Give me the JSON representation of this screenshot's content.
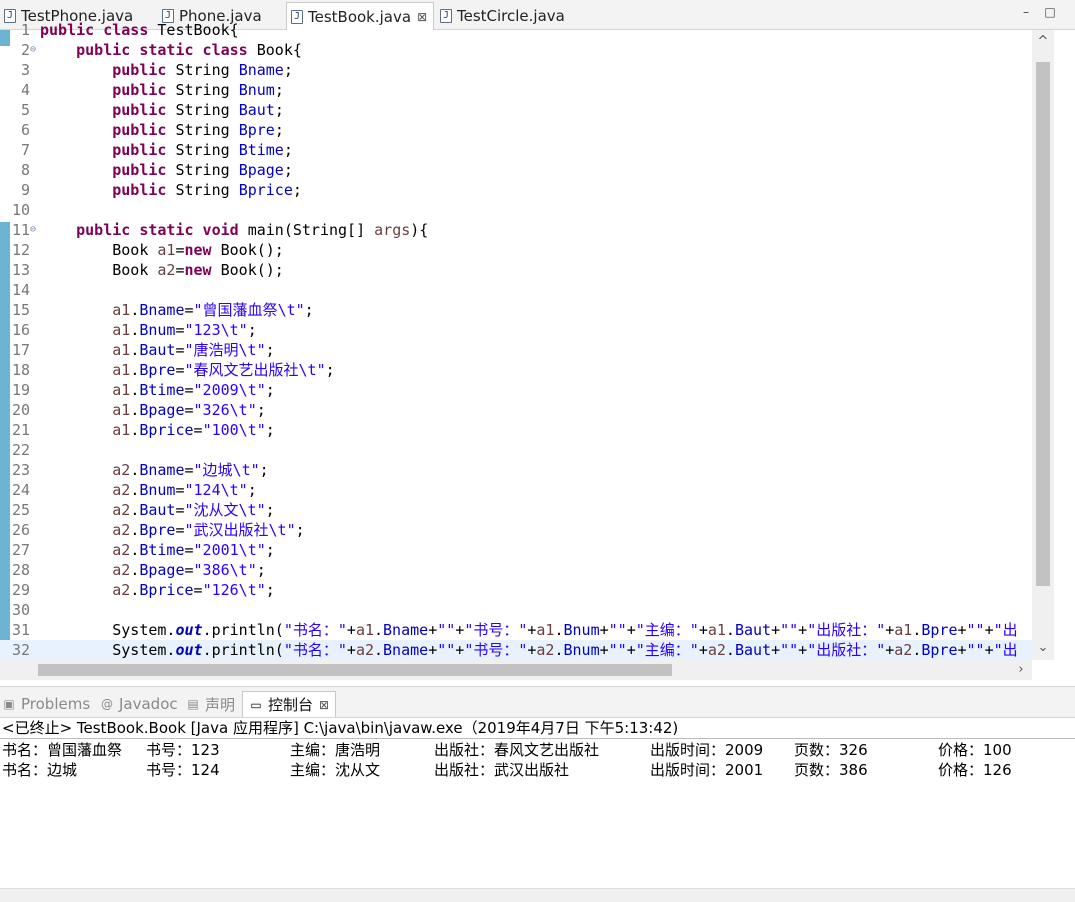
{
  "editor_tabs": [
    {
      "label": "TestPhone.java",
      "icon": "java-file-icon"
    },
    {
      "label": "Phone.java",
      "icon": "java-file-icon"
    },
    {
      "label": "TestBook.java",
      "icon": "java-file-icon",
      "active": true,
      "close": "⊠"
    },
    {
      "label": "TestCircle.java",
      "icon": "java-file-icon"
    }
  ],
  "window_buttons": {
    "minimize": "–",
    "maximize": "□"
  },
  "code_lines": [
    {
      "n": "1",
      "tokens": [
        {
          "t": "public class ",
          "c": "kw"
        },
        {
          "t": "TestBook{",
          "c": ""
        }
      ]
    },
    {
      "n": "2",
      "fold": "⊖",
      "tokens": [
        {
          "t": "    ",
          "c": ""
        },
        {
          "t": "public static class ",
          "c": "kw"
        },
        {
          "t": "Book{",
          "c": ""
        }
      ]
    },
    {
      "n": "3",
      "tokens": [
        {
          "t": "        ",
          "c": ""
        },
        {
          "t": "public ",
          "c": "kw"
        },
        {
          "t": "String ",
          "c": ""
        },
        {
          "t": "Bname",
          "c": "fld"
        },
        {
          "t": ";",
          "c": ""
        }
      ]
    },
    {
      "n": "4",
      "tokens": [
        {
          "t": "        ",
          "c": ""
        },
        {
          "t": "public ",
          "c": "kw"
        },
        {
          "t": "String ",
          "c": ""
        },
        {
          "t": "Bnum",
          "c": "fld"
        },
        {
          "t": ";",
          "c": ""
        }
      ]
    },
    {
      "n": "5",
      "tokens": [
        {
          "t": "        ",
          "c": ""
        },
        {
          "t": "public ",
          "c": "kw"
        },
        {
          "t": "String ",
          "c": ""
        },
        {
          "t": "Baut",
          "c": "fld"
        },
        {
          "t": ";",
          "c": ""
        }
      ]
    },
    {
      "n": "6",
      "tokens": [
        {
          "t": "        ",
          "c": ""
        },
        {
          "t": "public ",
          "c": "kw"
        },
        {
          "t": "String ",
          "c": ""
        },
        {
          "t": "Bpre",
          "c": "fld"
        },
        {
          "t": ";",
          "c": ""
        }
      ]
    },
    {
      "n": "7",
      "tokens": [
        {
          "t": "        ",
          "c": ""
        },
        {
          "t": "public ",
          "c": "kw"
        },
        {
          "t": "String ",
          "c": ""
        },
        {
          "t": "Btime",
          "c": "fld"
        },
        {
          "t": ";",
          "c": ""
        }
      ]
    },
    {
      "n": "8",
      "tokens": [
        {
          "t": "        ",
          "c": ""
        },
        {
          "t": "public ",
          "c": "kw"
        },
        {
          "t": "String ",
          "c": ""
        },
        {
          "t": "Bpage",
          "c": "fld"
        },
        {
          "t": ";",
          "c": ""
        }
      ]
    },
    {
      "n": "9",
      "tokens": [
        {
          "t": "        ",
          "c": ""
        },
        {
          "t": "public ",
          "c": "kw"
        },
        {
          "t": "String ",
          "c": ""
        },
        {
          "t": "Bprice",
          "c": "fld"
        },
        {
          "t": ";",
          "c": ""
        }
      ]
    },
    {
      "n": "10",
      "tokens": []
    },
    {
      "n": "11",
      "fold": "⊖",
      "tokens": [
        {
          "t": "    ",
          "c": ""
        },
        {
          "t": "public static void ",
          "c": "kw"
        },
        {
          "t": "main(String[] ",
          "c": ""
        },
        {
          "t": "args",
          "c": "var"
        },
        {
          "t": "){",
          "c": ""
        }
      ]
    },
    {
      "n": "12",
      "tokens": [
        {
          "t": "        Book ",
          "c": ""
        },
        {
          "t": "a1",
          "c": "var"
        },
        {
          "t": "=",
          "c": ""
        },
        {
          "t": "new ",
          "c": "kw"
        },
        {
          "t": "Book();",
          "c": ""
        }
      ]
    },
    {
      "n": "13",
      "tokens": [
        {
          "t": "        Book ",
          "c": ""
        },
        {
          "t": "a2",
          "c": "var"
        },
        {
          "t": "=",
          "c": ""
        },
        {
          "t": "new ",
          "c": "kw"
        },
        {
          "t": "Book();",
          "c": ""
        }
      ]
    },
    {
      "n": "14",
      "tokens": []
    },
    {
      "n": "15",
      "tokens": [
        {
          "t": "        ",
          "c": ""
        },
        {
          "t": "a1",
          "c": "var"
        },
        {
          "t": ".",
          "c": ""
        },
        {
          "t": "Bname",
          "c": "fld"
        },
        {
          "t": "=",
          "c": ""
        },
        {
          "t": "\"曾国藩血祭\\t\"",
          "c": "str"
        },
        {
          "t": ";",
          "c": ""
        }
      ]
    },
    {
      "n": "16",
      "tokens": [
        {
          "t": "        ",
          "c": ""
        },
        {
          "t": "a1",
          "c": "var"
        },
        {
          "t": ".",
          "c": ""
        },
        {
          "t": "Bnum",
          "c": "fld"
        },
        {
          "t": "=",
          "c": ""
        },
        {
          "t": "\"123\\t\"",
          "c": "str"
        },
        {
          "t": ";",
          "c": ""
        }
      ]
    },
    {
      "n": "17",
      "tokens": [
        {
          "t": "        ",
          "c": ""
        },
        {
          "t": "a1",
          "c": "var"
        },
        {
          "t": ".",
          "c": ""
        },
        {
          "t": "Baut",
          "c": "fld"
        },
        {
          "t": "=",
          "c": ""
        },
        {
          "t": "\"唐浩明\\t\"",
          "c": "str"
        },
        {
          "t": ";",
          "c": ""
        }
      ]
    },
    {
      "n": "18",
      "tokens": [
        {
          "t": "        ",
          "c": ""
        },
        {
          "t": "a1",
          "c": "var"
        },
        {
          "t": ".",
          "c": ""
        },
        {
          "t": "Bpre",
          "c": "fld"
        },
        {
          "t": "=",
          "c": ""
        },
        {
          "t": "\"春风文艺出版社\\t\"",
          "c": "str"
        },
        {
          "t": ";",
          "c": ""
        }
      ]
    },
    {
      "n": "19",
      "tokens": [
        {
          "t": "        ",
          "c": ""
        },
        {
          "t": "a1",
          "c": "var"
        },
        {
          "t": ".",
          "c": ""
        },
        {
          "t": "Btime",
          "c": "fld"
        },
        {
          "t": "=",
          "c": ""
        },
        {
          "t": "\"2009\\t\"",
          "c": "str"
        },
        {
          "t": ";",
          "c": ""
        }
      ]
    },
    {
      "n": "20",
      "tokens": [
        {
          "t": "        ",
          "c": ""
        },
        {
          "t": "a1",
          "c": "var"
        },
        {
          "t": ".",
          "c": ""
        },
        {
          "t": "Bpage",
          "c": "fld"
        },
        {
          "t": "=",
          "c": ""
        },
        {
          "t": "\"326\\t\"",
          "c": "str"
        },
        {
          "t": ";",
          "c": ""
        }
      ]
    },
    {
      "n": "21",
      "tokens": [
        {
          "t": "        ",
          "c": ""
        },
        {
          "t": "a1",
          "c": "var"
        },
        {
          "t": ".",
          "c": ""
        },
        {
          "t": "Bprice",
          "c": "fld"
        },
        {
          "t": "=",
          "c": ""
        },
        {
          "t": "\"100\\t\"",
          "c": "str"
        },
        {
          "t": ";",
          "c": ""
        }
      ]
    },
    {
      "n": "22",
      "tokens": []
    },
    {
      "n": "23",
      "tokens": [
        {
          "t": "        ",
          "c": ""
        },
        {
          "t": "a2",
          "c": "var"
        },
        {
          "t": ".",
          "c": ""
        },
        {
          "t": "Bname",
          "c": "fld"
        },
        {
          "t": "=",
          "c": ""
        },
        {
          "t": "\"边城\\t\"",
          "c": "str"
        },
        {
          "t": ";",
          "c": ""
        }
      ]
    },
    {
      "n": "24",
      "tokens": [
        {
          "t": "        ",
          "c": ""
        },
        {
          "t": "a2",
          "c": "var"
        },
        {
          "t": ".",
          "c": ""
        },
        {
          "t": "Bnum",
          "c": "fld"
        },
        {
          "t": "=",
          "c": ""
        },
        {
          "t": "\"124\\t\"",
          "c": "str"
        },
        {
          "t": ";",
          "c": ""
        }
      ]
    },
    {
      "n": "25",
      "tokens": [
        {
          "t": "        ",
          "c": ""
        },
        {
          "t": "a2",
          "c": "var"
        },
        {
          "t": ".",
          "c": ""
        },
        {
          "t": "Baut",
          "c": "fld"
        },
        {
          "t": "=",
          "c": ""
        },
        {
          "t": "\"沈从文\\t\"",
          "c": "str"
        },
        {
          "t": ";",
          "c": ""
        }
      ]
    },
    {
      "n": "26",
      "tokens": [
        {
          "t": "        ",
          "c": ""
        },
        {
          "t": "a2",
          "c": "var"
        },
        {
          "t": ".",
          "c": ""
        },
        {
          "t": "Bpre",
          "c": "fld"
        },
        {
          "t": "=",
          "c": ""
        },
        {
          "t": "\"武汉出版社\\t\"",
          "c": "str"
        },
        {
          "t": ";",
          "c": ""
        }
      ]
    },
    {
      "n": "27",
      "tokens": [
        {
          "t": "        ",
          "c": ""
        },
        {
          "t": "a2",
          "c": "var"
        },
        {
          "t": ".",
          "c": ""
        },
        {
          "t": "Btime",
          "c": "fld"
        },
        {
          "t": "=",
          "c": ""
        },
        {
          "t": "\"2001\\t\"",
          "c": "str"
        },
        {
          "t": ";",
          "c": ""
        }
      ]
    },
    {
      "n": "28",
      "tokens": [
        {
          "t": "        ",
          "c": ""
        },
        {
          "t": "a2",
          "c": "var"
        },
        {
          "t": ".",
          "c": ""
        },
        {
          "t": "Bpage",
          "c": "fld"
        },
        {
          "t": "=",
          "c": ""
        },
        {
          "t": "\"386\\t\"",
          "c": "str"
        },
        {
          "t": ";",
          "c": ""
        }
      ]
    },
    {
      "n": "29",
      "tokens": [
        {
          "t": "        ",
          "c": ""
        },
        {
          "t": "a2",
          "c": "var"
        },
        {
          "t": ".",
          "c": ""
        },
        {
          "t": "Bprice",
          "c": "fld"
        },
        {
          "t": "=",
          "c": ""
        },
        {
          "t": "\"126\\t\"",
          "c": "str"
        },
        {
          "t": ";",
          "c": ""
        }
      ]
    },
    {
      "n": "30",
      "tokens": []
    },
    {
      "n": "31",
      "tokens": [
        {
          "t": "        System.",
          "c": ""
        },
        {
          "t": "out",
          "c": "sf"
        },
        {
          "t": ".println(",
          "c": ""
        },
        {
          "t": "\"书名：\"",
          "c": "str"
        },
        {
          "t": "+",
          "c": ""
        },
        {
          "t": "a1",
          "c": "var"
        },
        {
          "t": ".",
          "c": ""
        },
        {
          "t": "Bname",
          "c": "fld"
        },
        {
          "t": "+",
          "c": ""
        },
        {
          "t": "\"\"",
          "c": "str"
        },
        {
          "t": "+",
          "c": ""
        },
        {
          "t": "\"书号：\"",
          "c": "str"
        },
        {
          "t": "+",
          "c": ""
        },
        {
          "t": "a1",
          "c": "var"
        },
        {
          "t": ".",
          "c": ""
        },
        {
          "t": "Bnum",
          "c": "fld"
        },
        {
          "t": "+",
          "c": ""
        },
        {
          "t": "\"\"",
          "c": "str"
        },
        {
          "t": "+",
          "c": ""
        },
        {
          "t": "\"主编：\"",
          "c": "str"
        },
        {
          "t": "+",
          "c": ""
        },
        {
          "t": "a1",
          "c": "var"
        },
        {
          "t": ".",
          "c": ""
        },
        {
          "t": "Baut",
          "c": "fld"
        },
        {
          "t": "+",
          "c": ""
        },
        {
          "t": "\"\"",
          "c": "str"
        },
        {
          "t": "+",
          "c": ""
        },
        {
          "t": "\"出版社：\"",
          "c": "str"
        },
        {
          "t": "+",
          "c": ""
        },
        {
          "t": "a1",
          "c": "var"
        },
        {
          "t": ".",
          "c": ""
        },
        {
          "t": "Bpre",
          "c": "fld"
        },
        {
          "t": "+",
          "c": ""
        },
        {
          "t": "\"\"",
          "c": "str"
        },
        {
          "t": "+",
          "c": ""
        },
        {
          "t": "\"出",
          "c": "str"
        }
      ]
    },
    {
      "n": "32",
      "current": true,
      "tokens": [
        {
          "t": "        System.",
          "c": ""
        },
        {
          "t": "out",
          "c": "sf"
        },
        {
          "t": ".println(",
          "c": ""
        },
        {
          "t": "\"书名：\"",
          "c": "str"
        },
        {
          "t": "+",
          "c": ""
        },
        {
          "t": "a2",
          "c": "var"
        },
        {
          "t": ".",
          "c": ""
        },
        {
          "t": "Bname",
          "c": "fld"
        },
        {
          "t": "+",
          "c": ""
        },
        {
          "t": "\"\"",
          "c": "str"
        },
        {
          "t": "+",
          "c": ""
        },
        {
          "t": "\"书号：\"",
          "c": "str"
        },
        {
          "t": "+",
          "c": ""
        },
        {
          "t": "a2",
          "c": "var"
        },
        {
          "t": ".",
          "c": ""
        },
        {
          "t": "Bnum",
          "c": "fld"
        },
        {
          "t": "+",
          "c": ""
        },
        {
          "t": "\"\"",
          "c": "str"
        },
        {
          "t": "+",
          "c": ""
        },
        {
          "t": "\"主编：\"",
          "c": "str"
        },
        {
          "t": "+",
          "c": ""
        },
        {
          "t": "a2",
          "c": "var"
        },
        {
          "t": ".",
          "c": ""
        },
        {
          "t": "Baut",
          "c": "fld"
        },
        {
          "t": "+",
          "c": ""
        },
        {
          "t": "\"\"",
          "c": "str"
        },
        {
          "t": "+",
          "c": ""
        },
        {
          "t": "\"出版社：\"",
          "c": "str"
        },
        {
          "t": "+",
          "c": ""
        },
        {
          "t": "a2",
          "c": "var"
        },
        {
          "t": ".",
          "c": ""
        },
        {
          "t": "Bpre",
          "c": "fld"
        },
        {
          "t": "+",
          "c": ""
        },
        {
          "t": "\"\"",
          "c": "str"
        },
        {
          "t": "+",
          "c": ""
        },
        {
          "t": "\"出",
          "c": "str"
        }
      ]
    }
  ],
  "scroll": {
    "up": "^",
    "down": "⌄",
    "right": "›"
  },
  "view_tabs": [
    {
      "label": "Problems",
      "icon": "problems-icon",
      "glyph": "▣"
    },
    {
      "label": "Javadoc",
      "icon": "at-icon",
      "glyph": "@"
    },
    {
      "label": "声明",
      "icon": "declaration-icon",
      "glyph": "▤"
    },
    {
      "label": "控制台",
      "icon": "console-icon",
      "glyph": "▭",
      "active": true,
      "close": "⊠"
    }
  ],
  "console": {
    "title": "<已终止> TestBook.Book [Java 应用程序] C:\\java\\bin\\javaw.exe（2019年4月7日 下午5:13:42)",
    "rows": [
      [
        "书名：曾国藩血祭",
        "书号：123",
        "主编：唐浩明",
        "出版社：春风文艺出版社",
        "出版时间：2009",
        "页数：326",
        "价格：100"
      ],
      [
        "书名：边城",
        "书号：124",
        "主编：沈从文",
        "出版社：武汉出版社",
        "出版时间：2001",
        "页数：386",
        "价格：126"
      ]
    ]
  },
  "colors": {
    "keyword": "#7f0055",
    "field": "#0000c0",
    "string": "#2a00ff",
    "local_var": "#6a3e3e",
    "gutter_marker": "#6fb3d2",
    "current_line": "#e8f2fe"
  }
}
